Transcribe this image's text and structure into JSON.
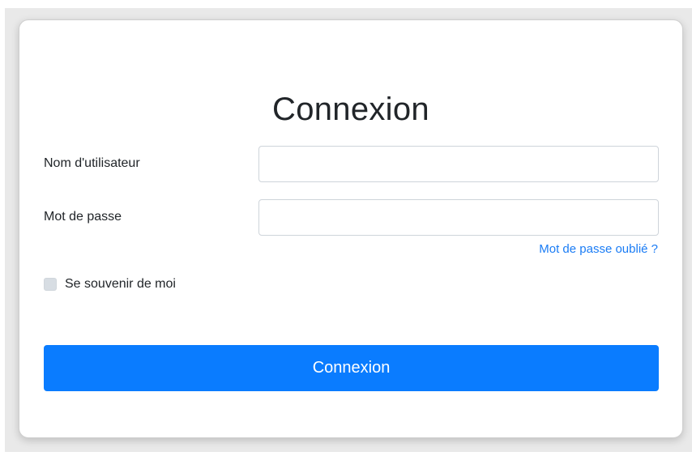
{
  "login_form": {
    "title": "Connexion",
    "username_label": "Nom d'utilisateur",
    "username_value": "",
    "password_label": "Mot de passe",
    "password_value": "",
    "forgot_password_link": "Mot de passe oublié ?",
    "remember_me_label": "Se souvenir de moi",
    "remember_me_checked": false,
    "submit_label": "Connexion"
  },
  "colors": {
    "accent": "#0a7cff",
    "link": "#1a7cf5",
    "border": "#ced4da",
    "checkbox_fill": "#d7dde3"
  }
}
